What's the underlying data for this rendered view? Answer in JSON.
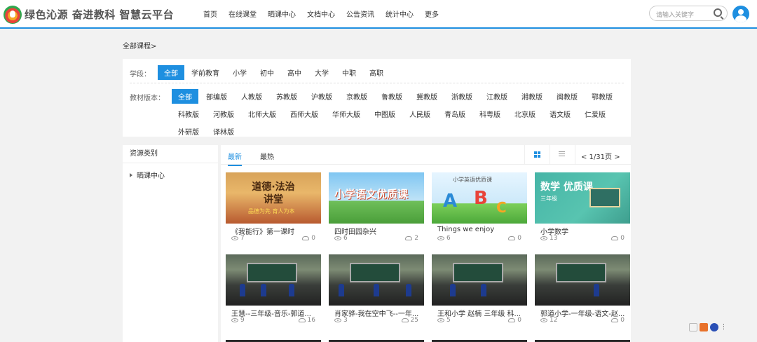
{
  "brand": {
    "name": "绿色沁源 奋进教科 智慧云平台"
  },
  "nav": [
    "首页",
    "在线课堂",
    "晒课中心",
    "文档中心",
    "公告资讯",
    "统计中心",
    "更多"
  ],
  "search": {
    "placeholder": "请输入关键字"
  },
  "breadcrumb": "全部课程>",
  "filters": {
    "stage_label": "学段：",
    "stages": [
      "全部",
      "学前教育",
      "小学",
      "初中",
      "高中",
      "大学",
      "中职",
      "高职"
    ],
    "edition_label": "教材版本：",
    "editions": [
      "全部",
      "部编版",
      "人教版",
      "苏教版",
      "沪教版",
      "京教版",
      "鲁教版",
      "冀教版",
      "浙教版",
      "江教版",
      "湘教版",
      "闽教版",
      "鄂教版",
      "科教版",
      "河教版",
      "北师大版",
      "西师大版",
      "华师大版",
      "中图版",
      "人民版",
      "青岛版",
      "科粤版",
      "北京版",
      "语文版",
      "仁爱版",
      "外研版",
      "译林版"
    ]
  },
  "sidebar": {
    "title": "资源类别",
    "items": [
      "晒课中心"
    ]
  },
  "main": {
    "tabs": [
      "最新",
      "最热"
    ],
    "pager": "< 1/31页 >"
  },
  "thumb_text": {
    "moral_title": "道德·法治 讲堂",
    "moral_sub": "品德为先 育人为本",
    "chinese_title": "小学语文优质课",
    "english_top": "小学英语优质课",
    "math_title": "数学 优质课",
    "math_sub": "三年级"
  },
  "cards": [
    {
      "title": "《我能行》第一课时",
      "views": "7",
      "downloads": "0",
      "thumb": "moral"
    },
    {
      "title": "四时田园杂兴",
      "views": "6",
      "downloads": "2",
      "thumb": "chinese"
    },
    {
      "title": "Things we enjoy",
      "views": "6",
      "downloads": "0",
      "thumb": "eng"
    },
    {
      "title": "小学数学",
      "views": "13",
      "downloads": "0",
      "thumb": "math"
    },
    {
      "title": "王慧--三年级-音乐-郭道...",
      "views": "9",
      "downloads": "16",
      "thumb": "class"
    },
    {
      "title": "肖家骅-我在空中飞--一年...",
      "views": "3",
      "downloads": "25",
      "thumb": "class"
    },
    {
      "title": "王和小学 赵楠 三年级 科...",
      "views": "5",
      "downloads": "0",
      "thumb": "class"
    },
    {
      "title": "郭道小学-一年级-语文-赵...",
      "views": "12",
      "downloads": "0",
      "thumb": "class"
    }
  ]
}
